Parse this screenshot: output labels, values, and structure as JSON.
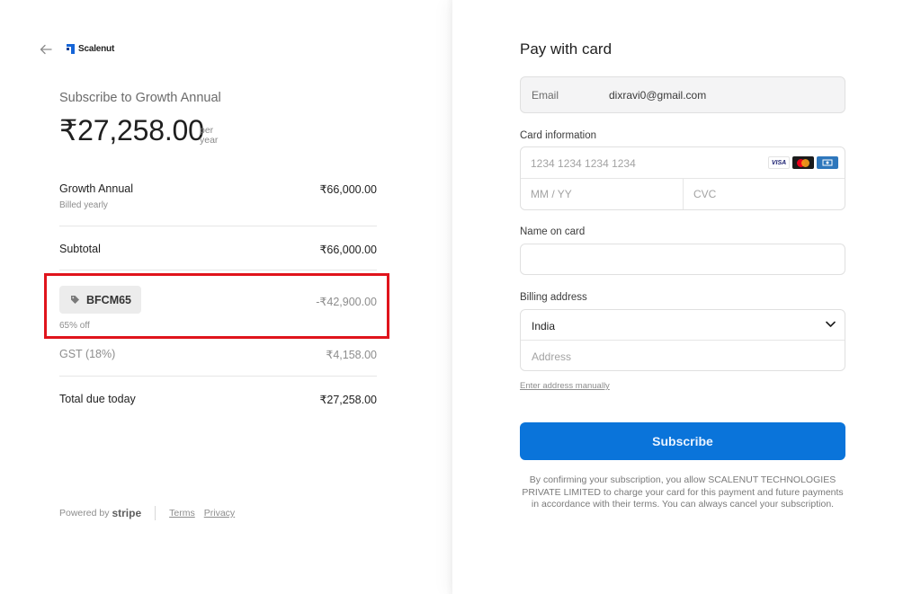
{
  "brand": {
    "name": "Scalenut"
  },
  "summary": {
    "title": "Subscribe to Growth Annual",
    "price": "₹27,258.00",
    "period_line1": "per",
    "period_line2": "year"
  },
  "line_items": {
    "plan_name": "Growth Annual",
    "plan_billing": "Billed yearly",
    "plan_price": "₹66,000.00",
    "subtotal_label": "Subtotal",
    "subtotal_value": "₹66,000.00",
    "coupon_code": "BFCM65",
    "coupon_discount": "-₹42,900.00",
    "coupon_note": "65% off",
    "tax_label": "GST (18%)",
    "tax_value": "₹4,158.00",
    "total_label": "Total due today",
    "total_value": "₹27,258.00"
  },
  "footer": {
    "powered_by": "Powered by",
    "stripe": "stripe",
    "terms": "Terms",
    "privacy": "Privacy"
  },
  "payment": {
    "title": "Pay with card",
    "email_label": "Email",
    "email_value": "dixravi0@gmail.com",
    "card_label": "Card information",
    "card_number_placeholder": "1234 1234 1234 1234",
    "expiry_placeholder": "MM / YY",
    "cvc_placeholder": "CVC",
    "card_brands": [
      "VISA",
      "mastercard",
      "amex"
    ],
    "name_label": "Name on card",
    "name_value": "",
    "billing_label": "Billing address",
    "country": "India",
    "address_placeholder": "Address",
    "manual_link": "Enter address manually",
    "subscribe_label": "Subscribe",
    "terms_text": "By confirming your subscription, you allow SCALENUT TECHNOLOGIES PRIVATE LIMITED to charge your card for this payment and future payments in accordance with their terms. You can always cancel your subscription."
  },
  "colors": {
    "accent": "#0a74da",
    "highlight": "#e0141c",
    "brand_blue": "#1565d8"
  }
}
